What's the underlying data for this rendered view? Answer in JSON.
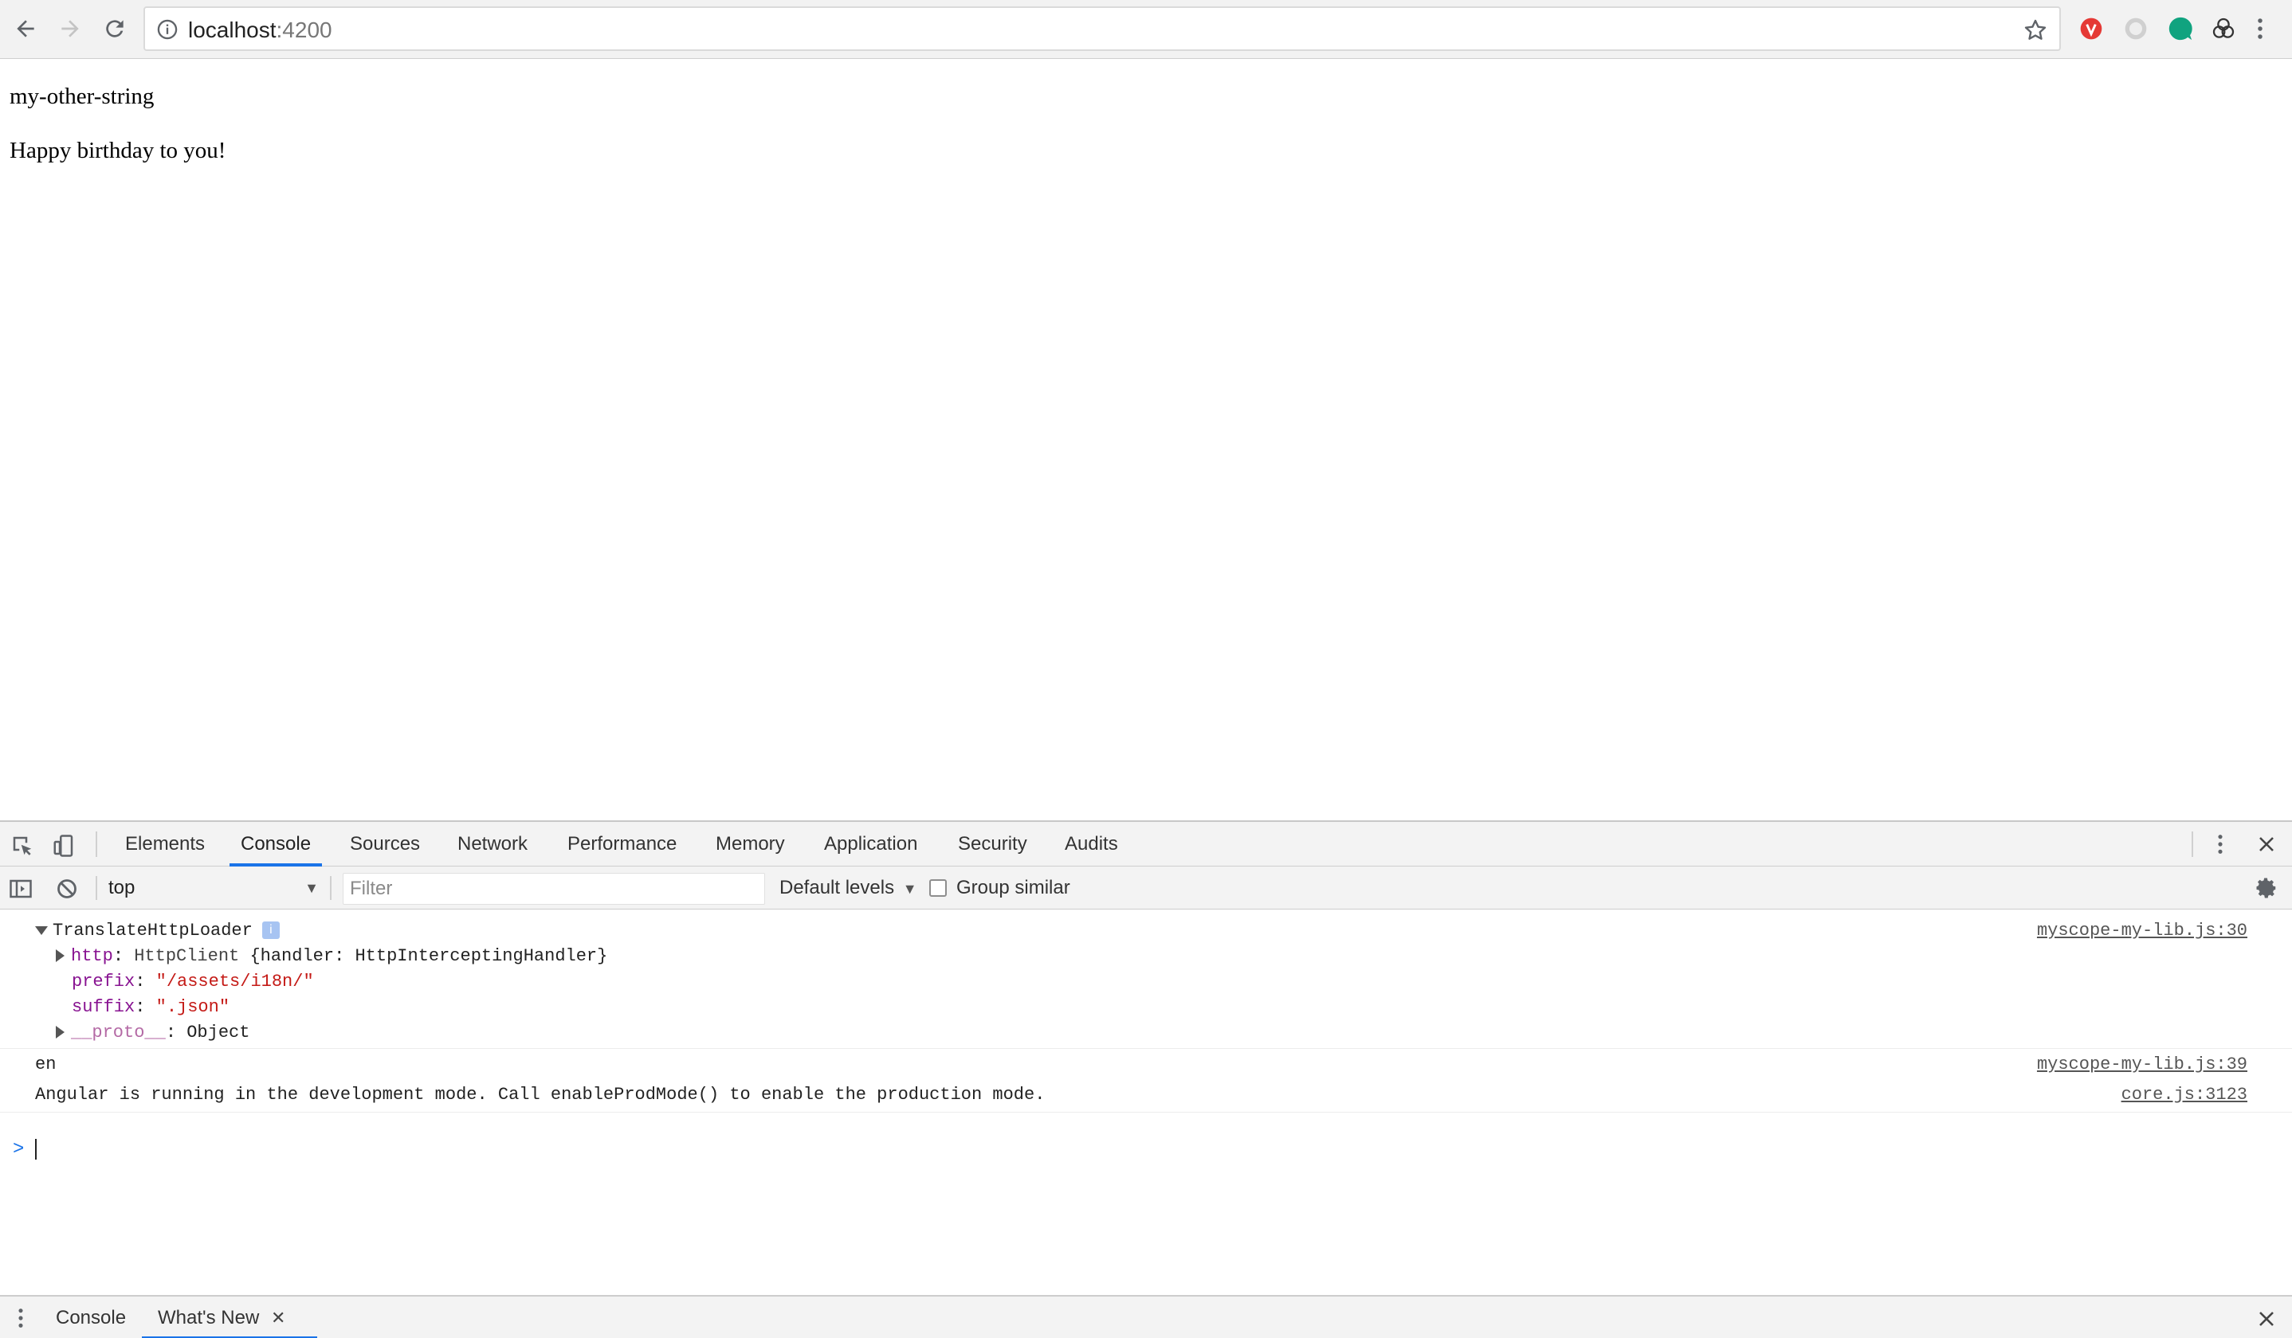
{
  "browser": {
    "url_host": "localhost",
    "url_port": ":4200",
    "icons": [
      "back-arrow-icon",
      "forward-arrow-icon",
      "reload-icon",
      "info-icon",
      "star-icon",
      "kebab-menu-icon"
    ],
    "extensions": [
      {
        "name": "red-extension-icon",
        "color": "#e53935"
      },
      {
        "name": "gray-extension-icon",
        "color": "#bdbdbd"
      },
      {
        "name": "green-extension-icon",
        "color": "#10a37f"
      },
      {
        "name": "swirl-extension-icon",
        "color": "#333333"
      }
    ]
  },
  "page": {
    "lines": [
      "my-other-string",
      "Happy birthday to you!"
    ]
  },
  "devtools": {
    "tabs": [
      "Elements",
      "Console",
      "Sources",
      "Network",
      "Performance",
      "Memory",
      "Application",
      "Security",
      "Audits"
    ],
    "active_tab": "Console",
    "accent": "#1a73e8",
    "toolbar": {
      "context": "top",
      "filter_placeholder": "Filter",
      "levels": "Default levels",
      "group_similar": "Group similar"
    },
    "console": {
      "object_name": "TranslateHttpLoader",
      "object_badge": "i",
      "props": {
        "http_key": "http",
        "http_type": "HttpClient",
        "http_value": "{handler: HttpInterceptingHandler}",
        "prefix_key": "prefix",
        "prefix_value": "\"/assets/i18n/\"",
        "suffix_key": "suffix",
        "suffix_value": "\".json\"",
        "proto_key": "__proto__",
        "proto_value": "Object"
      },
      "source_1": "myscope-my-lib.js:30",
      "message_2": "en",
      "source_2": "myscope-my-lib.js:39",
      "message_3": "Angular is running in the development mode. Call enableProdMode() to enable the production mode.",
      "source_3": "core.js:3123",
      "prompt": ">"
    },
    "drawer": {
      "tabs": [
        "Console",
        "What's New"
      ],
      "active_tab": "What's New",
      "close_glyph": "✕"
    }
  }
}
